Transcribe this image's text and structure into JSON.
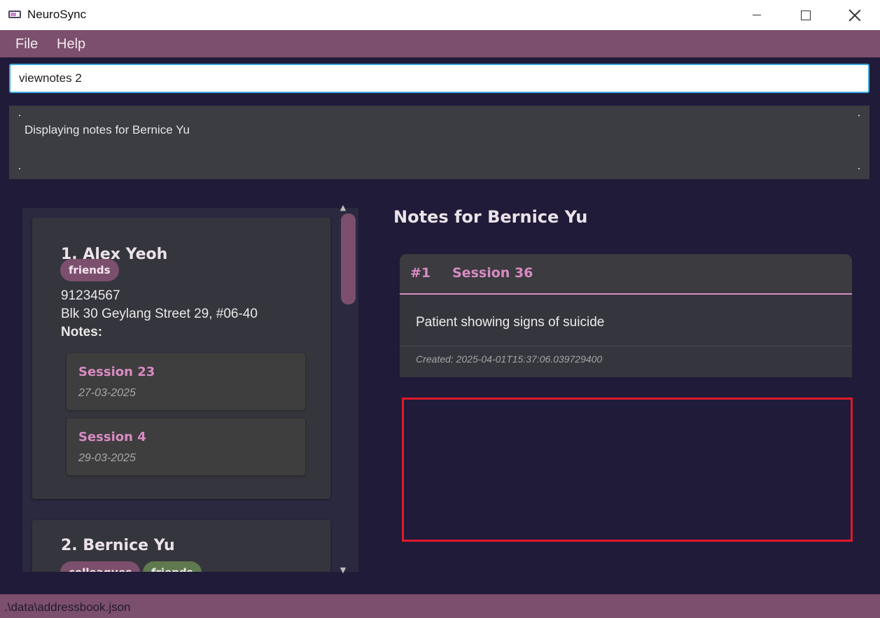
{
  "window": {
    "title": "NeuroSync",
    "icon": "app-logo-icon"
  },
  "menu": {
    "file": "File",
    "help": "Help"
  },
  "command": {
    "value": "viewnotes 2"
  },
  "result": {
    "text": "Displaying notes for Bernice Yu"
  },
  "persons": [
    {
      "name": "1.  Alex Yeoh",
      "tags": [
        "friends"
      ],
      "phone": "91234567",
      "address": "Blk 30 Geylang Street 29, #06-40",
      "notes_label": "Notes:",
      "notes": [
        {
          "title": "Session 23",
          "date": "27-03-2025"
        },
        {
          "title": "Session 4",
          "date": "29-03-2025"
        }
      ]
    },
    {
      "name": "2.  Bernice Yu",
      "tags": [
        "colleagues",
        "friends"
      ]
    }
  ],
  "notes_panel": {
    "title": "Notes for Bernice Yu",
    "notes": [
      {
        "index": "#1",
        "title": "Session 36",
        "content": "Patient showing signs of suicide",
        "created": "Created: 2025-04-01T15:37:06.039729400"
      }
    ]
  },
  "status": {
    "path": ".\\data\\addressbook.json"
  },
  "colors": {
    "accent": "#7b4f6d",
    "background": "#1f1b38",
    "note_title": "#d98bc3",
    "tag_friends": "#7b4f6d",
    "tag_colleagues": "#7b4f6d",
    "tag_friends_2": "#5f7a4f",
    "highlight": "#e0192d"
  }
}
